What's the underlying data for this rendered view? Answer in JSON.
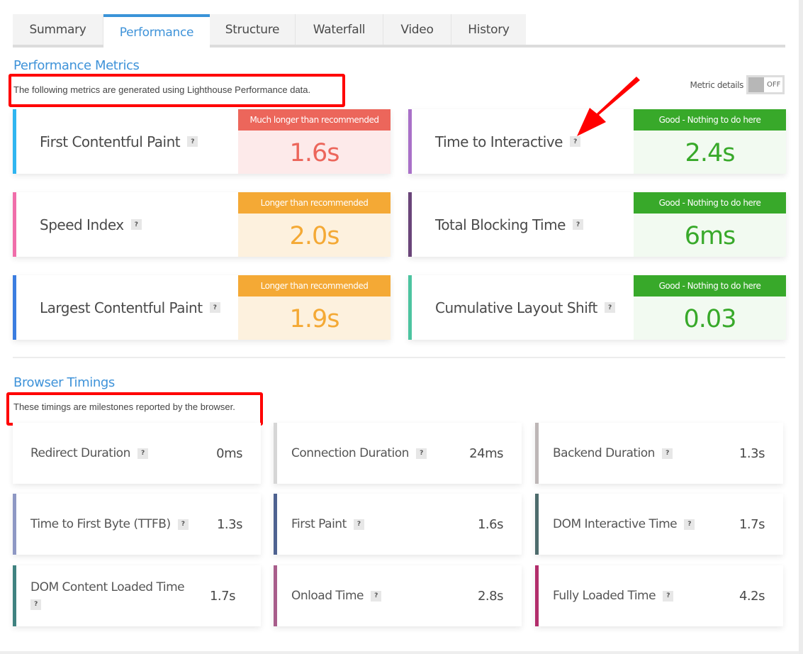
{
  "tabs": [
    {
      "label": "Summary",
      "active": false
    },
    {
      "label": "Performance",
      "active": true
    },
    {
      "label": "Structure",
      "active": false
    },
    {
      "label": "Waterfall",
      "active": false
    },
    {
      "label": "Video",
      "active": false
    },
    {
      "label": "History",
      "active": false
    }
  ],
  "performance_metrics": {
    "title": "Performance Metrics",
    "description": "The following metrics are generated using Lighthouse Performance data.",
    "toggle": {
      "label": "Metric details",
      "state": "OFF"
    },
    "help_icon": "?",
    "metrics": [
      {
        "name": "First Contentful Paint",
        "grade": "Much longer than recommended",
        "value": "1.6s",
        "accent": "#2fb5f0",
        "grade_color": "#ec665b",
        "value_bg": "#fdeaea",
        "value_color": "#ec665b"
      },
      {
        "name": "Time to Interactive",
        "grade": "Good - Nothing to do here",
        "value": "2.4s",
        "accent": "#a970c8",
        "grade_color": "#38a92a",
        "value_bg": "#f2faf1",
        "value_color": "#38a92a"
      },
      {
        "name": "Speed Index",
        "grade": "Longer than recommended",
        "value": "2.0s",
        "accent": "#f06eaa",
        "grade_color": "#f4a935",
        "value_bg": "#fdf1de",
        "value_color": "#f4a935"
      },
      {
        "name": "Total Blocking Time",
        "grade": "Good - Nothing to do here",
        "value": "6ms",
        "accent": "#6a4579",
        "grade_color": "#38a92a",
        "value_bg": "#f2faf1",
        "value_color": "#38a92a"
      },
      {
        "name": "Largest Contentful Paint",
        "grade": "Longer than recommended",
        "value": "1.9s",
        "accent": "#3b7de0",
        "grade_color": "#f4a935",
        "value_bg": "#fdf1de",
        "value_color": "#f4a935"
      },
      {
        "name": "Cumulative Layout Shift",
        "grade": "Good - Nothing to do here",
        "value": "0.03",
        "accent": "#4cc4a0",
        "grade_color": "#38a92a",
        "value_bg": "#f2faf1",
        "value_color": "#38a92a"
      }
    ]
  },
  "browser_timings": {
    "title": "Browser Timings",
    "description": "These timings are milestones reported by the browser.",
    "timings": [
      {
        "name": "Redirect Duration",
        "value": "0ms",
        "accent": "#ffffff"
      },
      {
        "name": "Connection Duration",
        "value": "24ms",
        "accent": "#d6d6d6"
      },
      {
        "name": "Backend Duration",
        "value": "1.3s",
        "accent": "#bdb6b6"
      },
      {
        "name": "Time to First Byte (TTFB)",
        "value": "1.3s",
        "accent": "#8e98c4"
      },
      {
        "name": "First Paint",
        "value": "1.6s",
        "accent": "#4e6290"
      },
      {
        "name": "DOM Interactive Time",
        "value": "1.7s",
        "accent": "#4d6b6c"
      },
      {
        "name": "DOM Content Loaded Time",
        "value": "1.7s",
        "accent": "#3f8280"
      },
      {
        "name": "Onload Time",
        "value": "2.8s",
        "accent": "#a85d8b"
      },
      {
        "name": "Fully Loaded Time",
        "value": "4.2s",
        "accent": "#b22d6b"
      }
    ]
  },
  "annotations": {
    "highlight_color": "#ff0000",
    "arrow_target": "Time to Interactive help icon"
  }
}
